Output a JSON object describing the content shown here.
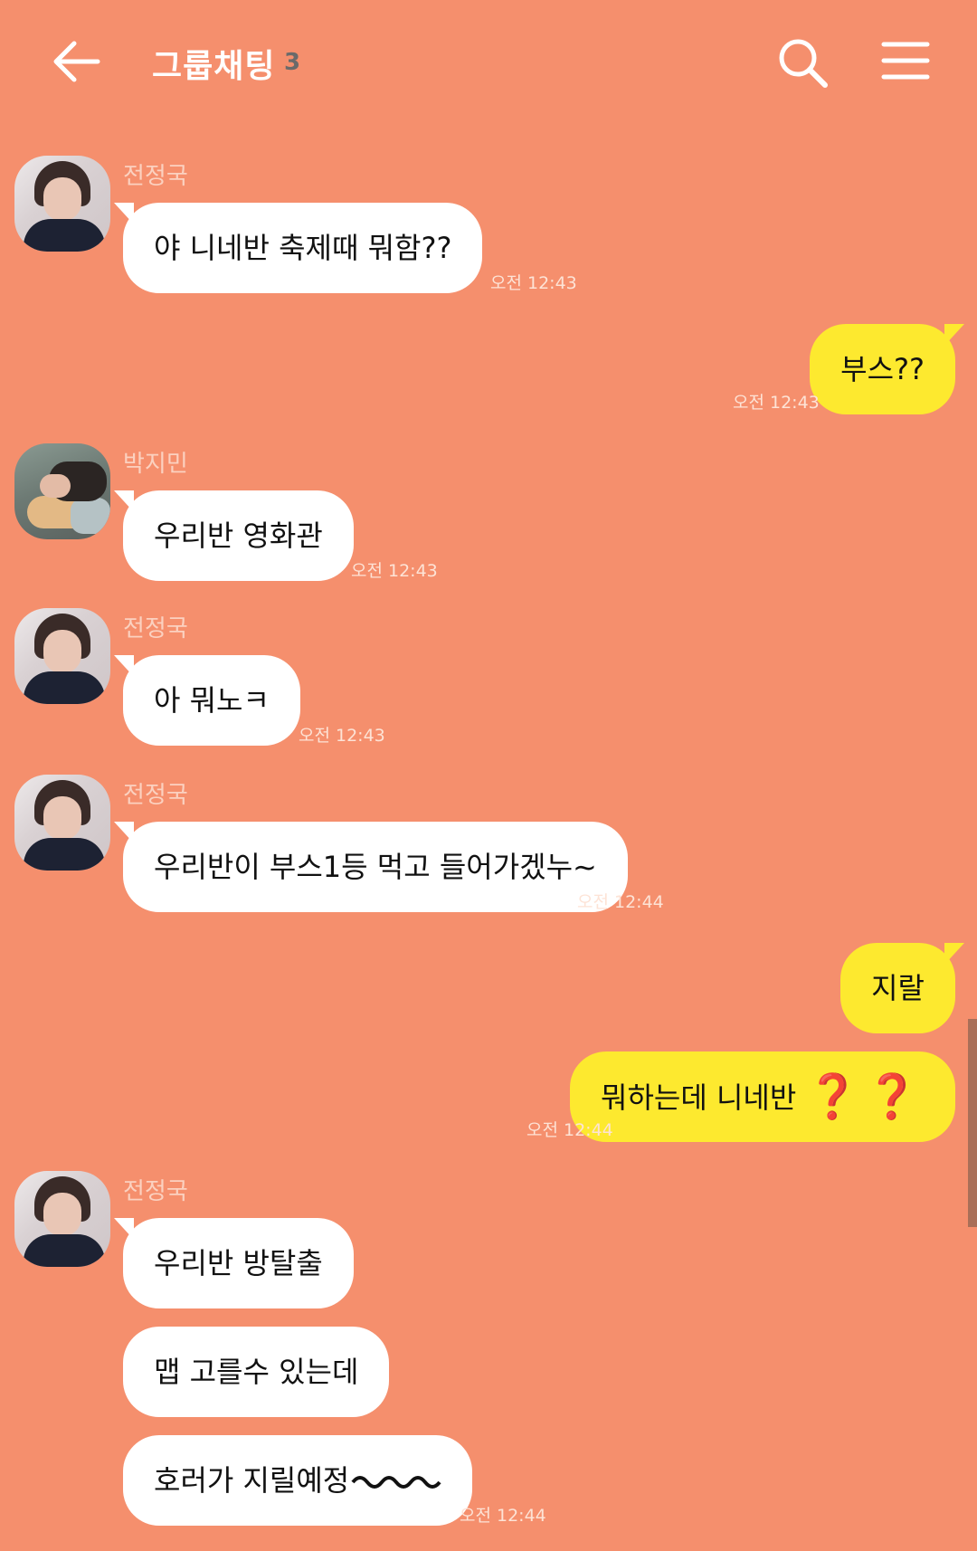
{
  "header": {
    "title": "그룹채팅",
    "member_count": "3",
    "back_icon": "back-arrow-icon",
    "search_icon": "search-icon",
    "menu_icon": "hamburger-menu-icon"
  },
  "colors": {
    "background": "#f58f6d",
    "my_bubble": "#fde92f",
    "other_bubble": "#ffffff",
    "question_mark": "#d11b1b"
  },
  "messages": [
    {
      "sender": "전정국",
      "text": "야 니네반 축제때 뭐함??",
      "time": "오전 12:43"
    },
    {
      "sender": "me",
      "text": "부스??",
      "time": "오전 12:43"
    },
    {
      "sender": "박지민",
      "text": "우리반 영화관",
      "time": "오전 12:43"
    },
    {
      "sender": "전정국",
      "text": "아 뭐노ㅋ",
      "time": "오전 12:43"
    },
    {
      "sender": "전정국",
      "text": "우리반이 부스1등 먹고 들어가겠누~",
      "time": "오전 12:44"
    },
    {
      "sender": "me",
      "text": "지랄"
    },
    {
      "sender": "me",
      "text": "뭐하는데 니네반",
      "emoji": "❓❓",
      "time": "오전 12:44"
    },
    {
      "sender": "전정국",
      "text": "우리반 방탈출"
    },
    {
      "sender": "전정국",
      "text": "맵 고를수 있는데"
    },
    {
      "sender": "전정국",
      "text": "호러가 지릴예정",
      "time": "오전 12:44"
    }
  ]
}
